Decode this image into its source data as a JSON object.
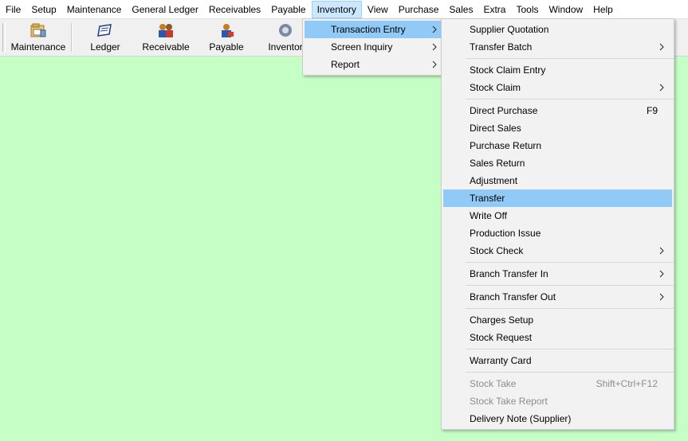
{
  "menubar": {
    "items": [
      "File",
      "Setup",
      "Maintenance",
      "General Ledger",
      "Receivables",
      "Payable",
      "Inventory",
      "View",
      "Purchase",
      "Sales",
      "Extra",
      "Tools",
      "Window",
      "Help"
    ]
  },
  "toolbar": {
    "buttons": [
      {
        "label": "Maintenance",
        "icon": "maintenance-icon"
      },
      {
        "label": "Ledger",
        "icon": "ledger-icon"
      },
      {
        "label": "Receivable",
        "icon": "receivable-icon"
      },
      {
        "label": "Payable",
        "icon": "payable-icon"
      },
      {
        "label": "Inventor",
        "icon": "inventory-icon"
      }
    ]
  },
  "inventory_menu": {
    "items": [
      {
        "label": "Transaction Entry",
        "submenu": true,
        "highlighted": true
      },
      {
        "label": "Screen Inquiry",
        "submenu": true
      },
      {
        "label": "Report",
        "submenu": true
      }
    ]
  },
  "transaction_menu": {
    "items": [
      {
        "label": "Supplier Quotation"
      },
      {
        "label": "Transfer Batch",
        "submenu": true
      },
      {
        "sep": true
      },
      {
        "label": "Stock Claim Entry"
      },
      {
        "label": "Stock Claim",
        "submenu": true
      },
      {
        "sep": true
      },
      {
        "label": "Direct Purchase",
        "shortcut": "F9"
      },
      {
        "label": "Direct Sales"
      },
      {
        "label": "Purchase Return"
      },
      {
        "label": "Sales Return"
      },
      {
        "label": "Adjustment"
      },
      {
        "label": "Transfer",
        "highlighted": true
      },
      {
        "label": "Write Off"
      },
      {
        "label": "Production Issue"
      },
      {
        "label": "Stock Check",
        "submenu": true
      },
      {
        "sep": true
      },
      {
        "label": "Branch Transfer In",
        "submenu": true
      },
      {
        "sep": true
      },
      {
        "label": "Branch Transfer Out",
        "submenu": true
      },
      {
        "sep": true
      },
      {
        "label": "Charges Setup"
      },
      {
        "label": "Stock Request"
      },
      {
        "sep": true
      },
      {
        "label": "Warranty Card"
      },
      {
        "sep": true
      },
      {
        "label": "Stock Take",
        "shortcut": "Shift+Ctrl+F12",
        "disabled": true
      },
      {
        "label": "Stock Take Report",
        "disabled": true
      },
      {
        "label": "Delivery Note (Supplier)"
      }
    ]
  },
  "colors": {
    "workspace": "#c6ffc6",
    "highlight": "#91c9f7",
    "menubar_open": "#cce8ff"
  }
}
